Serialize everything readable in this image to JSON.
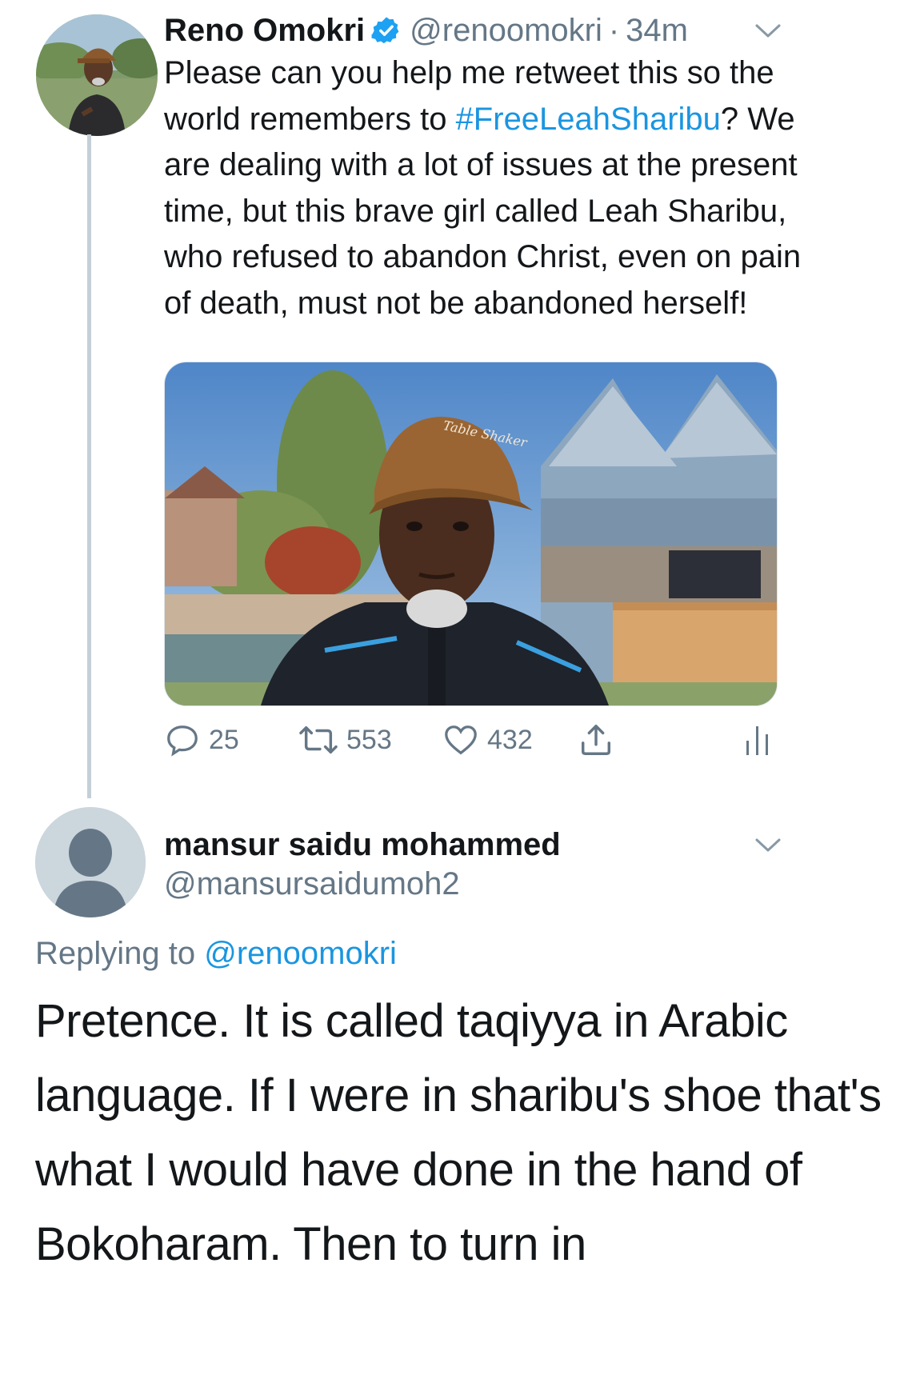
{
  "tweet": {
    "author_name": "Reno Omokri",
    "verified": true,
    "handle": "@renoomokri",
    "separator": "·",
    "time": "34m",
    "text_before": "Please can you help me retweet this so the world remembers to ",
    "hashtag": "#FreeLeahSharibu",
    "text_after": "? We are dealing with a lot of issues at the present time, but this brave girl called Leah Sharibu, who refused to abandon Christ, even on pain of death, must not be abandoned herself!",
    "cap_text": "Table Shaker",
    "replies": "25",
    "retweets": "553",
    "likes": "432"
  },
  "reply": {
    "author_name": "mansur saidu mohammed",
    "handle": "@mansursaidumoh2",
    "replying_label": "Replying to ",
    "replying_handle": "@renoomokri",
    "text": "Pretence. It is called taqiyya in Arabic language. If I were in sharibu's shoe that's what I would have done in the hand of Bokoharam.  Then to turn in"
  },
  "colors": {
    "accent": "#1b95e0",
    "muted": "#657786",
    "text": "#14171a",
    "thread_line": "#c4cfd6"
  },
  "icons": [
    "reply-icon",
    "retweet-icon",
    "like-icon",
    "share-icon",
    "analytics-icon",
    "chevron-down-icon",
    "verified-badge-icon",
    "default-avatar-icon"
  ]
}
